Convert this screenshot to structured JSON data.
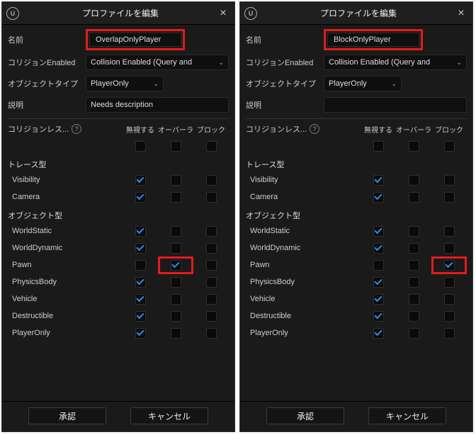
{
  "dialogs": [
    {
      "title": "プロファイルを編集",
      "close": "×",
      "name_label": "名前",
      "name_value": "OverlapOnlyPlayer",
      "collision_enabled_label": "コリジョンEnabled",
      "collision_enabled_value": "Collision Enabled (Query and",
      "object_type_label": "オブジェクトタイプ",
      "object_type_value": "PlayerOnly",
      "description_label": "説明",
      "description_value": "Needs description",
      "collision_responses_label": "コリジョンレス...",
      "col_ignore": "無視する",
      "col_overlap": "オーバーラ",
      "col_block": "ブロック",
      "all_row_checks": [
        false,
        false,
        false
      ],
      "trace_heading": "トレース型",
      "trace_rows": [
        {
          "label": "Visibility",
          "checks": [
            true,
            false,
            false
          ]
        },
        {
          "label": "Camera",
          "checks": [
            true,
            false,
            false
          ]
        }
      ],
      "object_heading": "オブジェクト型",
      "object_rows": [
        {
          "label": "WorldStatic",
          "checks": [
            true,
            false,
            false
          ]
        },
        {
          "label": "WorldDynamic",
          "checks": [
            true,
            false,
            false
          ]
        },
        {
          "label": "Pawn",
          "checks": [
            false,
            true,
            false
          ],
          "highlight_col": 1
        },
        {
          "label": "PhysicsBody",
          "checks": [
            true,
            false,
            false
          ]
        },
        {
          "label": "Vehicle",
          "checks": [
            true,
            false,
            false
          ]
        },
        {
          "label": "Destructible",
          "checks": [
            true,
            false,
            false
          ]
        },
        {
          "label": "PlayerOnly",
          "checks": [
            true,
            false,
            false
          ]
        }
      ],
      "accept": "承認",
      "cancel": "キャンセル"
    },
    {
      "title": "プロファイルを編集",
      "close": "×",
      "name_label": "名前",
      "name_value": "BlockOnlyPlayer",
      "collision_enabled_label": "コリジョンEnabled",
      "collision_enabled_value": "Collision Enabled (Query and",
      "object_type_label": "オブジェクトタイプ",
      "object_type_value": "PlayerOnly",
      "description_label": "説明",
      "description_value": "",
      "collision_responses_label": "コリジョンレス...",
      "col_ignore": "無視する",
      "col_overlap": "オーバーラ",
      "col_block": "ブロック",
      "all_row_checks": [
        false,
        false,
        false
      ],
      "trace_heading": "トレース型",
      "trace_rows": [
        {
          "label": "Visibility",
          "checks": [
            true,
            false,
            false
          ]
        },
        {
          "label": "Camera",
          "checks": [
            true,
            false,
            false
          ]
        }
      ],
      "object_heading": "オブジェクト型",
      "object_rows": [
        {
          "label": "WorldStatic",
          "checks": [
            true,
            false,
            false
          ]
        },
        {
          "label": "WorldDynamic",
          "checks": [
            true,
            false,
            false
          ]
        },
        {
          "label": "Pawn",
          "checks": [
            false,
            false,
            true
          ],
          "highlight_col": 2
        },
        {
          "label": "PhysicsBody",
          "checks": [
            true,
            false,
            false
          ]
        },
        {
          "label": "Vehicle",
          "checks": [
            true,
            false,
            false
          ]
        },
        {
          "label": "Destructible",
          "checks": [
            true,
            false,
            false
          ]
        },
        {
          "label": "PlayerOnly",
          "checks": [
            true,
            false,
            false
          ]
        }
      ],
      "accept": "承認",
      "cancel": "キャンセル"
    }
  ]
}
